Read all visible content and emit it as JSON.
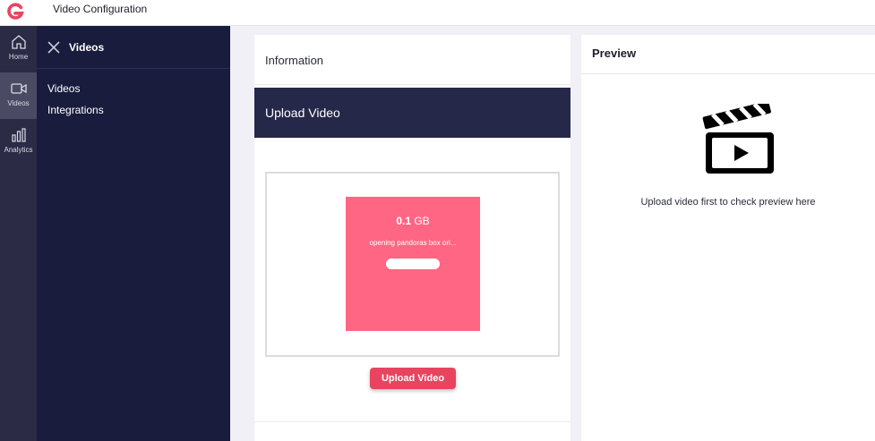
{
  "topbar": {
    "title": "Video Configuration"
  },
  "rail": {
    "items": [
      {
        "label": "Home",
        "icon": "home-icon"
      },
      {
        "label": "Videos",
        "icon": "video-camera-icon"
      },
      {
        "label": "Analytics",
        "icon": "bar-chart-icon"
      }
    ]
  },
  "subnav": {
    "title": "Videos",
    "links": [
      "Videos",
      "Integrations"
    ]
  },
  "steps": {
    "information": "Information",
    "upload": "Upload Video"
  },
  "upload": {
    "size_value": "0.1",
    "size_unit": "GB",
    "file_name": "opening pandoras box ori...",
    "progress": 1.0,
    "button_label": "Upload Video"
  },
  "preview": {
    "title": "Preview",
    "message": "Upload video first to check preview here"
  },
  "colors": {
    "sidebar_dark": "#1a1c3d",
    "rail": "#2b2b45",
    "step_active": "#262849",
    "file_card": "#ff6683",
    "button": "#e8445f",
    "logo": "#e8445f"
  }
}
